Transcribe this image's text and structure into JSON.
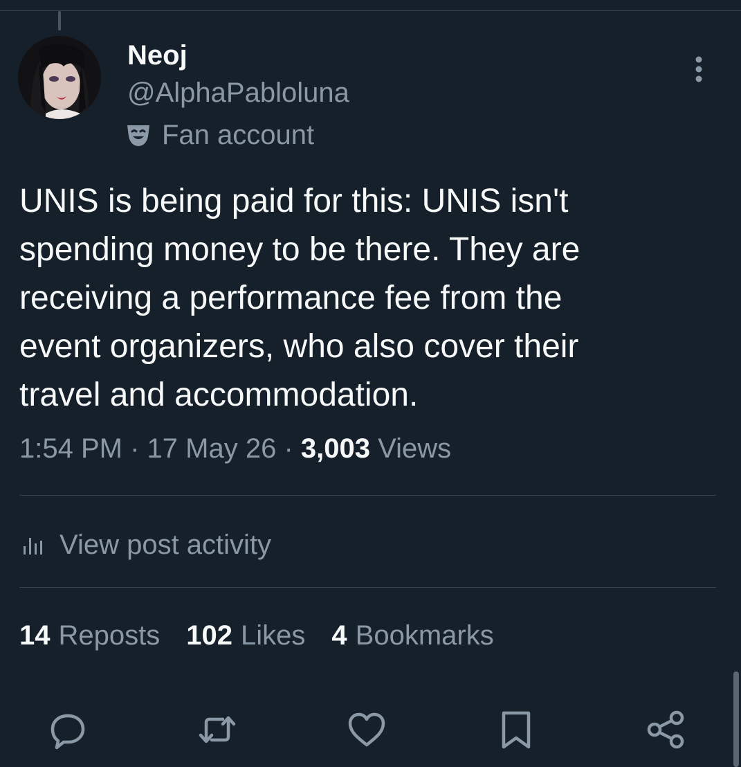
{
  "author": {
    "display_name": "Neoj",
    "handle": "@AlphaPabloluna",
    "label": "Fan account",
    "label_icon": "theater-masks-icon",
    "avatar_icon": "avatar-portrait"
  },
  "post": {
    "text_lines": [
      "UNIS is being paid for this: UNIS isn't",
      "spending money to be there. They are",
      "receiving a performance fee from the",
      "event organizers, who also cover their",
      "travel and accommodation."
    ],
    "time": "1:54 PM",
    "date": "17 May 26",
    "separator": "·",
    "views_count": "3,003",
    "views_label": "Views"
  },
  "activity": {
    "label": "View post activity",
    "icon": "bar-chart-icon"
  },
  "stats": {
    "reposts_count": "14",
    "reposts_label": "Reposts",
    "likes_count": "102",
    "likes_label": "Likes",
    "bookmarks_count": "4",
    "bookmarks_label": "Bookmarks"
  },
  "actions": [
    "reply-icon",
    "repost-icon",
    "like-icon",
    "bookmark-icon",
    "share-icon"
  ],
  "colors": {
    "background": "#15202b",
    "primary_text": "#f7f9f9",
    "secondary_text": "#8b98a5",
    "divider": "#38444d"
  }
}
